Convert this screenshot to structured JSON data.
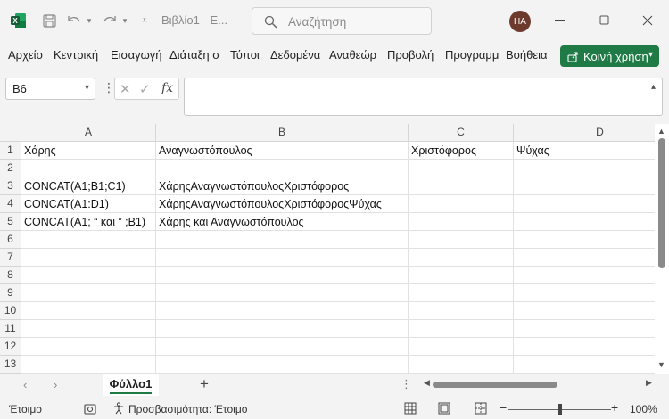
{
  "window": {
    "title": "Βιβλίο1 - Ε...",
    "search_placeholder": "Αναζήτηση",
    "user_initials": "HA"
  },
  "ribbon": {
    "tabs": [
      "Αρχείο",
      "Κεντρική",
      "Εισαγωγή",
      "Διάταξη σ",
      "Τύποι",
      "Δεδομένα",
      "Αναθεώρ",
      "Προβολή",
      "Προγραμμ",
      "Βοήθεια"
    ],
    "share_label": "Κοινή χρήση"
  },
  "formula_bar": {
    "name_box": "B6",
    "fx_label": "fx",
    "content": ""
  },
  "grid": {
    "columns": [
      "A",
      "B",
      "C",
      "D"
    ],
    "rows": [
      "1",
      "2",
      "3",
      "4",
      "5",
      "6",
      "7",
      "8",
      "9",
      "10",
      "11",
      "12",
      "13"
    ],
    "cells": {
      "A1": "Χάρης",
      "B1": "Αναγνωστόπουλος",
      "C1": "Χριστόφορος",
      "D1": "Ψύχας",
      "A3": "CONCAT(A1;B1;C1)",
      "B3": "ΧάρηςΑναγνωστόπουλοςΧριστόφορος",
      "A4": "CONCAT(A1:D1)",
      "B4": "ΧάρηςΑναγνωστόπουλοςΧριστόφοροςΨύχας",
      "A5": "CONCAT(A1; “ και ” ;B1)",
      "B5": "Χάρης και Αναγνωστόπουλος"
    }
  },
  "sheet_tabs": {
    "active": "Φύλλο1",
    "add_label": "+"
  },
  "status_bar": {
    "ready": "Έτοιμο",
    "accessibility": "Προσβασιμότητα: Έτοιμο",
    "zoom": "100%",
    "zoom_minus": "−",
    "zoom_plus": "+"
  },
  "colors": {
    "accent": "#1f7a45",
    "avatar": "#6e3a2e"
  }
}
